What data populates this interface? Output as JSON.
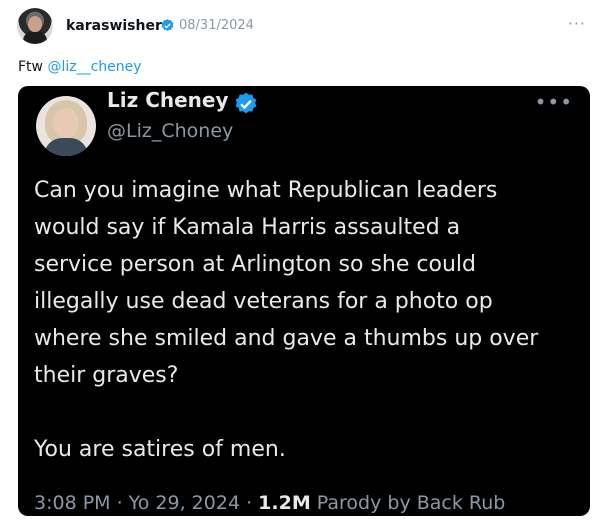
{
  "post": {
    "username": "karaswisher",
    "date": "08/31/2024",
    "more": "···",
    "caption_text": "Ftw ",
    "caption_mention": "@liz__cheney"
  },
  "embedded": {
    "name": "Liz Cheney",
    "handle": "@Liz_Choney",
    "more": "•••",
    "body_lines": [
      "Can you imagine what Republican leaders",
      "would say if Kamala Harris assaulted a",
      "service person at Arlington so she could",
      "illegally use dead veterans for a photo op",
      "where she smiled and gave a thumbs up over",
      "their graves?"
    ],
    "body_last": "You are satires of men.",
    "footer_time": "3:08 PM · Yo 29, 2024 · ",
    "footer_views": "1.2M",
    "footer_source": " Parody by Back Rub"
  },
  "colors": {
    "verified": "#1d9bf0",
    "mention": "#1d9bf0",
    "embed_bg": "#000000"
  },
  "icons": {
    "verified": "verified-badge-icon",
    "more": "more-options-icon"
  }
}
